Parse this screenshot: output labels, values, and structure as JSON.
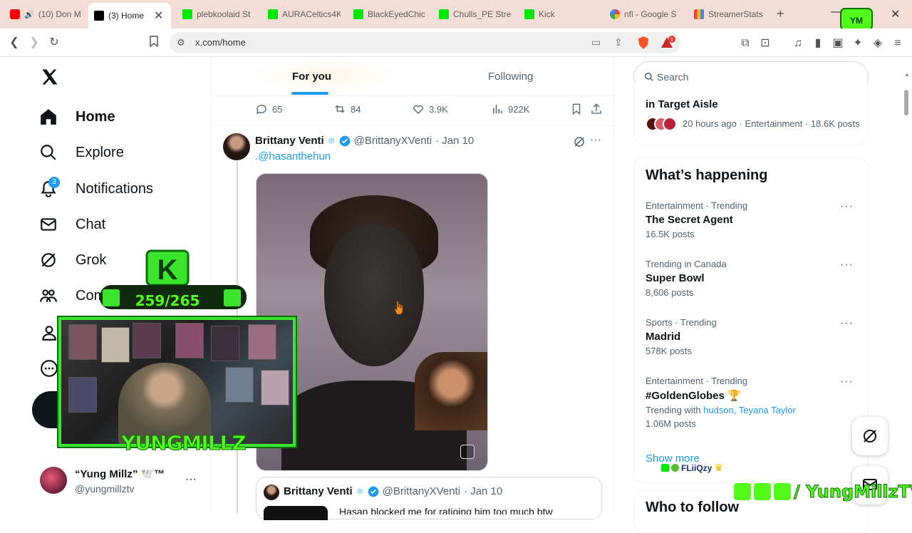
{
  "browser": {
    "tabs": [
      {
        "label": "(10) Don M",
        "icon": "youtube-icon"
      },
      {
        "label": "(3) Home",
        "icon": "x-logo-icon",
        "active": true
      },
      {
        "label": "plebkoolaid St",
        "icon": "kick-icon"
      },
      {
        "label": "AURACeltics4K",
        "icon": "kick-icon"
      },
      {
        "label": "BlackEyedChic",
        "icon": "kick-icon"
      },
      {
        "label": "Chulls_PE Stre",
        "icon": "kick-icon"
      },
      {
        "label": "Kick",
        "icon": "kick-icon"
      },
      {
        "label": "nfl - Google S",
        "icon": "google-icon"
      },
      {
        "label": "StreamerStats",
        "icon": "stats-icon"
      }
    ],
    "url": "x.com/home"
  },
  "nav": {
    "items": [
      {
        "label": "Home",
        "icon": "home-icon"
      },
      {
        "label": "Explore",
        "icon": "search-icon"
      },
      {
        "label": "Notifications",
        "icon": "bell-icon",
        "badge": "3"
      },
      {
        "label": "Chat",
        "icon": "mail-icon"
      },
      {
        "label": "Grok",
        "icon": "grok-icon"
      },
      {
        "label": "Com",
        "icon": "communities-icon"
      }
    ],
    "profile": {
      "name": "“Yung Millz” 🕊️™",
      "handle": "@yungmillztv"
    }
  },
  "feed": {
    "tabs": {
      "for_you": "For you",
      "following": "Following"
    },
    "metrics": {
      "replies": "65",
      "reposts": "84",
      "likes": "3.9K",
      "views": "922K"
    },
    "post": {
      "author": "Brittany Venti",
      "handle": "@BrittanyXVenti",
      "date": "· Jan 10",
      "mention": ".@hasanthehun"
    },
    "quoted": {
      "author": "Brittany Venti",
      "handle": "@BrittanyXVenti",
      "date": "· Jan 10",
      "text": "Hasan blocked me for ratioing him too much btw"
    }
  },
  "sidebar": {
    "search_placeholder": "Search",
    "top_trend": {
      "title": "in Target Aisle",
      "meta": "20 hours ago · Entertainment · 18.6K posts"
    },
    "happening_title": "What’s happening",
    "trends": [
      {
        "meta": "Entertainment · Trending",
        "name": "The Secret Agent",
        "count": "16.5K posts"
      },
      {
        "meta": "Trending in Canada",
        "name": "Super Bowl",
        "count": "8,606 posts"
      },
      {
        "meta": "Sports · Trending",
        "name": "Madrid",
        "count": "578K posts"
      },
      {
        "meta": "Entertainment · Trending",
        "name": "#GoldenGlobes 🏆",
        "count": "1.06M posts",
        "with_label": "Trending with",
        "with_1": "hudson",
        "with_2": "Teyana Taylor"
      }
    ],
    "show_more": "Show more",
    "who_to_follow": "Who to follow"
  },
  "overlay": {
    "counter": "259/265",
    "streamer_name": "YUNGMILLZ",
    "social": "/ YungMillzTV",
    "chat_tag": "FLiiQzy"
  },
  "colors": {
    "accent": "#1d9bf0",
    "kick_green": "#53fc18",
    "text": "#0f1419",
    "muted": "#536471"
  }
}
